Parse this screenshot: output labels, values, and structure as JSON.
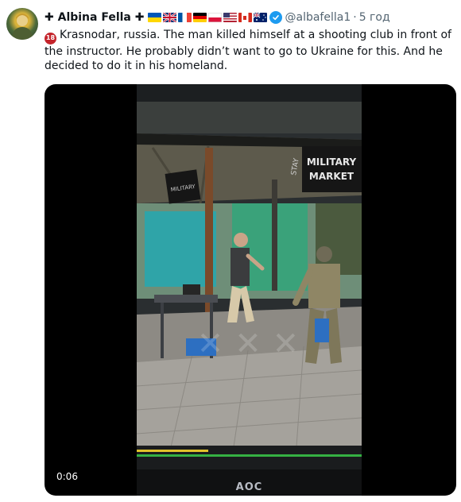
{
  "tweet": {
    "display_name": "✚ Albina Fella ✚",
    "handle": "@albafella1",
    "separator": "·",
    "time": "5 год",
    "flags": [
      "ukraine-flag",
      "uk-flag",
      "france-flag",
      "germany-flag",
      "poland-flag",
      "usa-flag",
      "canada-flag",
      "australia-flag"
    ],
    "age_badge": "18",
    "text": "Krasnodar, russia. The man killed himself at a shooting club in front of the instructor. He probably didn’t want to go to Ukraine for this. And he decided to do it in his homeland."
  },
  "video": {
    "timestamp": "0:06",
    "sign_text_1": "MILITARY",
    "sign_text_2": "MARKET",
    "sign_text_small": "STAY",
    "monitor_brand": "AOC"
  },
  "colors": {
    "verified": "#1d9bf0",
    "age_badge": "#c4242b",
    "secondary_text": "#536471"
  }
}
